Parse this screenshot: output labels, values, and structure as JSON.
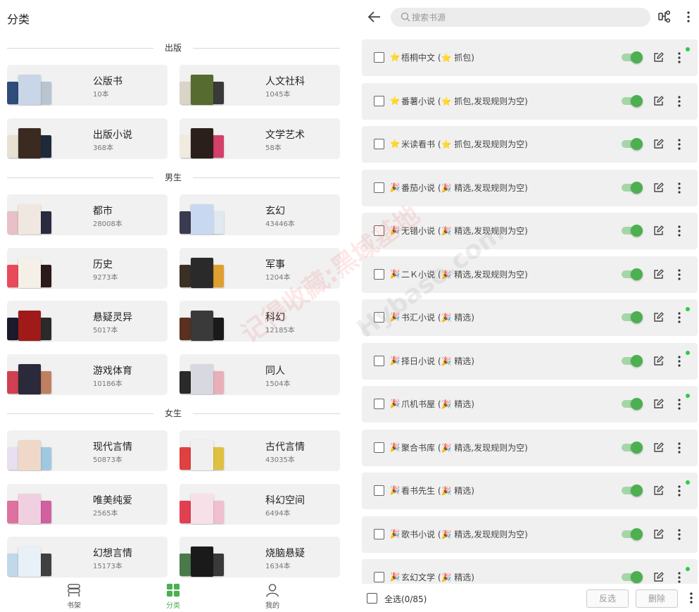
{
  "left": {
    "title": "分类",
    "sections": [
      {
        "label": "出版",
        "items": [
          {
            "name": "公版书",
            "count": "10本",
            "colors": [
              "#2e4d7a",
              "#c8d6e8",
              "#b8c4d0"
            ]
          },
          {
            "name": "人文社科",
            "count": "1045本",
            "colors": [
              "#d9d4c8",
              "#556b2f",
              "#3a3a3a"
            ]
          },
          {
            "name": "出版小说",
            "count": "368本",
            "colors": [
              "#e8e0d0",
              "#3a2a20",
              "#1e2a3a"
            ]
          },
          {
            "name": "文学艺术",
            "count": "58本",
            "colors": [
              "#f0eadf",
              "#2a1f1a",
              "#d4406a"
            ]
          }
        ]
      },
      {
        "label": "男生",
        "items": [
          {
            "name": "都市",
            "count": "28008本",
            "colors": [
              "#e8c0c8",
              "#f0e8e0",
              "#2a2a40"
            ]
          },
          {
            "name": "玄幻",
            "count": "43446本",
            "colors": [
              "#3a3a50",
              "#c8d8f0",
              "#e0e8f0"
            ]
          },
          {
            "name": "历史",
            "count": "9273本",
            "colors": [
              "#e84a5a",
              "#f4f0e8",
              "#2a1a1a"
            ]
          },
          {
            "name": "军事",
            "count": "1204本",
            "colors": [
              "#3a3025",
              "#2a2a2a",
              "#e0a030"
            ]
          },
          {
            "name": "悬疑灵异",
            "count": "5017本",
            "colors": [
              "#1a1a2a",
              "#a01a1a",
              "#2a2a2a"
            ]
          },
          {
            "name": "科幻",
            "count": "12185本",
            "colors": [
              "#5a3020",
              "#3a3a3a",
              "#1a1a1a"
            ]
          },
          {
            "name": "游戏体育",
            "count": "10186本",
            "colors": [
              "#d04050",
              "#2a2a3a",
              "#c08060"
            ]
          },
          {
            "name": "同人",
            "count": "1504本",
            "colors": [
              "#2a2a2a",
              "#d8d8e0",
              "#e8b0b8"
            ]
          }
        ]
      },
      {
        "label": "女生",
        "items": [
          {
            "name": "现代言情",
            "count": "50873本",
            "colors": [
              "#e8e0f0",
              "#f0d8c8",
              "#a0c8e0"
            ]
          },
          {
            "name": "古代言情",
            "count": "43035本",
            "colors": [
              "#e04040",
              "#f0f0f0",
              "#e0c040"
            ]
          },
          {
            "name": "唯美纯爱",
            "count": "2565本",
            "colors": [
              "#e070a0",
              "#f0d0e0",
              "#d060a0"
            ]
          },
          {
            "name": "科幻空间",
            "count": "6494本",
            "colors": [
              "#e04050",
              "#f8e0e8",
              "#f0c0d0"
            ]
          },
          {
            "name": "幻想言情",
            "count": "15173本",
            "colors": [
              "#c0d8e8",
              "#e8f0f8",
              "#404040"
            ]
          },
          {
            "name": "烧脑悬疑",
            "count": "1634本",
            "colors": [
              "#4a7a4a",
              "#1a1a1a",
              "#3a3a3a"
            ]
          }
        ]
      }
    ],
    "nav": [
      {
        "label": "书架",
        "icon": "bookshelf-icon",
        "active": false
      },
      {
        "label": "分类",
        "icon": "grid-icon",
        "active": true
      },
      {
        "label": "我的",
        "icon": "person-icon",
        "active": false
      }
    ],
    "accent": "#4caf50"
  },
  "right": {
    "search_placeholder": "搜索书源",
    "sources": [
      {
        "icon": "⭐",
        "label": "梧桐中文 (⭐ 抓包)",
        "dot": true
      },
      {
        "icon": "⭐",
        "label": "番薯小说 (⭐ 抓包,发现规则为空)",
        "dot": false
      },
      {
        "icon": "⭐",
        "label": "米读看书 (⭐ 抓包,发现规则为空)",
        "dot": false
      },
      {
        "icon": "🎉",
        "label": "番茄小说 (🎉 精选,发现规则为空)",
        "dot": false
      },
      {
        "icon": "🎉",
        "label": "无错小说 (🎉 精选,发现规则为空)",
        "dot": false
      },
      {
        "icon": "🎉",
        "label": "二Ｋ小说 (🎉 精选,发现规则为空)",
        "dot": false
      },
      {
        "icon": "🎉",
        "label": "书汇小说 (🎉 精选)",
        "dot": true
      },
      {
        "icon": "🎉",
        "label": "择日小说 (🎉 精选)",
        "dot": true
      },
      {
        "icon": "🎉",
        "label": "爪机书屋 (🎉 精选)",
        "dot": true
      },
      {
        "icon": "🎉",
        "label": "聚合书库 (🎉 精选,发现规则为空)",
        "dot": false
      },
      {
        "icon": "🎉",
        "label": "看书先生 (🎉 精选)",
        "dot": true
      },
      {
        "icon": "🎉",
        "label": "歌书小说 (🎉 精选,发现规则为空)",
        "dot": false
      },
      {
        "icon": "🎉",
        "label": "玄幻文学 (🎉 精选)",
        "dot": true
      }
    ],
    "select_all": "全选(0/85)",
    "invert": "反选",
    "delete": "删除",
    "toggle_color": "#4caf50"
  },
  "watermark": {
    "text_cn": "记得收藏:黑域基地",
    "text_en": "Hybase.com"
  }
}
